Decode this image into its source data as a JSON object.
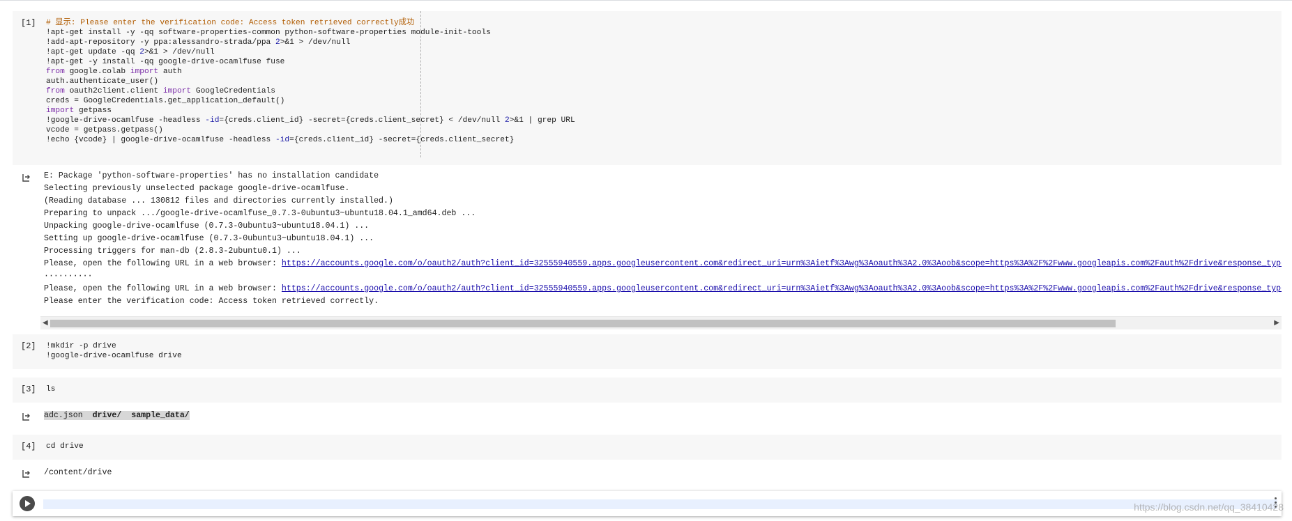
{
  "cells": [
    {
      "num": "[1]",
      "lines": [
        [
          {
            "t": "# 显示: Please enter the verification code: Access token retrieved correctly成功",
            "c": "cm"
          }
        ],
        [
          {
            "t": "!apt-get install -y -qq software-properties-common python-software-properties module-init-tools"
          }
        ],
        [
          {
            "t": "!add-apt-repository -y ppa:alessandro-strada/ppa "
          },
          {
            "t": "2",
            "c": "op"
          },
          {
            "t": ">&1 > /dev/null"
          }
        ],
        [
          {
            "t": "!apt-get update -qq "
          },
          {
            "t": "2",
            "c": "op"
          },
          {
            "t": ">&1 > /dev/null"
          }
        ],
        [
          {
            "t": "!apt-get -y install -qq google-drive-ocamlfuse fuse"
          }
        ],
        [
          {
            "t": "from",
            "c": "kw"
          },
          {
            "t": " google.colab "
          },
          {
            "t": "import",
            "c": "kw"
          },
          {
            "t": " auth"
          }
        ],
        [
          {
            "t": "auth.authenticate_user()"
          }
        ],
        [
          {
            "t": "from",
            "c": "kw"
          },
          {
            "t": " oauth2client.client "
          },
          {
            "t": "import",
            "c": "kw"
          },
          {
            "t": " GoogleCredentials"
          }
        ],
        [
          {
            "t": "creds = GoogleCredentials.get_application_default()"
          }
        ],
        [
          {
            "t": "import",
            "c": "kw"
          },
          {
            "t": " getpass"
          }
        ],
        [
          {
            "t": "!google-drive-ocamlfuse -headless "
          },
          {
            "t": "-id",
            "c": "op"
          },
          {
            "t": "={creds.client_id} -secret={creds.client_secret} < /dev/null "
          },
          {
            "t": "2",
            "c": "op"
          },
          {
            "t": ">&1 | grep URL"
          }
        ],
        [
          {
            "t": "vcode = getpass.getpass()"
          }
        ],
        [
          {
            "t": "!echo {vcode} | google-drive-ocamlfuse -headless "
          },
          {
            "t": "-id",
            "c": "op"
          },
          {
            "t": "={creds.client_id} -secret={creds.client_secret}"
          }
        ]
      ]
    },
    {
      "num": "[2]",
      "lines": [
        [
          {
            "t": "!mkdir -p drive"
          }
        ],
        [
          {
            "t": "!google-drive-ocamlfuse drive"
          }
        ]
      ]
    },
    {
      "num": "[3]",
      "lines": [
        [
          {
            "t": "ls"
          }
        ]
      ]
    },
    {
      "num": "[4]",
      "lines": [
        [
          {
            "t": "cd drive"
          }
        ]
      ]
    }
  ],
  "outputs": {
    "out1": [
      [
        {
          "t": "E: Package 'python-software-properties' has no installation candidate"
        }
      ],
      [
        {
          "t": "Selecting previously unselected package google-drive-ocamlfuse."
        }
      ],
      [
        {
          "t": "(Reading database ... 130812 files and directories currently installed.)"
        }
      ],
      [
        {
          "t": "Preparing to unpack .../google-drive-ocamlfuse_0.7.3-0ubuntu3~ubuntu18.04.1_amd64.deb ..."
        }
      ],
      [
        {
          "t": "Unpacking google-drive-ocamlfuse (0.7.3-0ubuntu3~ubuntu18.04.1) ..."
        }
      ],
      [
        {
          "t": "Setting up google-drive-ocamlfuse (0.7.3-0ubuntu3~ubuntu18.04.1) ..."
        }
      ],
      [
        {
          "t": "Processing triggers for man-db (2.8.3-2ubuntu0.1) ..."
        }
      ],
      [
        {
          "t": "Please, open the following URL in a web browser: "
        },
        {
          "t": "https://accounts.google.com/o/oauth2/auth?client_id=32555940559.apps.googleusercontent.com&redirect_uri=urn%3Aietf%3Awg%3Aoauth%3A2.0%3Aoob&scope=https%3A%2F%2Fwww.googleapis.com%2Fauth%2Fdrive&response_type",
          "c": "link"
        }
      ],
      [
        {
          "t": "··········"
        }
      ],
      [
        {
          "t": "Please, open the following URL in a web browser: "
        },
        {
          "t": "https://accounts.google.com/o/oauth2/auth?client_id=32555940559.apps.googleusercontent.com&redirect_uri=urn%3Aietf%3Awg%3Aoauth%3A2.0%3Aoob&scope=https%3A%2F%2Fwww.googleapis.com%2Fauth%2Fdrive&response_type",
          "c": "link"
        }
      ],
      [
        {
          "t": "Please enter the verification code: Access token retrieved correctly."
        }
      ]
    ],
    "out3": [
      [
        {
          "t": "adc.json",
          "c": "hl"
        },
        {
          "t": "  ",
          "c": "hl"
        },
        {
          "t": "drive/",
          "c": "hl bold"
        },
        {
          "t": "  ",
          "c": "hl"
        },
        {
          "t": "sample_data/",
          "c": "hl bold"
        }
      ]
    ],
    "out4": [
      [
        {
          "t": "/content/drive"
        }
      ]
    ]
  },
  "watermark": "https://blog.csdn.net/qq_38410428",
  "icons": {
    "output": "output-arrow-icon",
    "run": "run-cell-icon",
    "more": "more-vert-icon"
  }
}
